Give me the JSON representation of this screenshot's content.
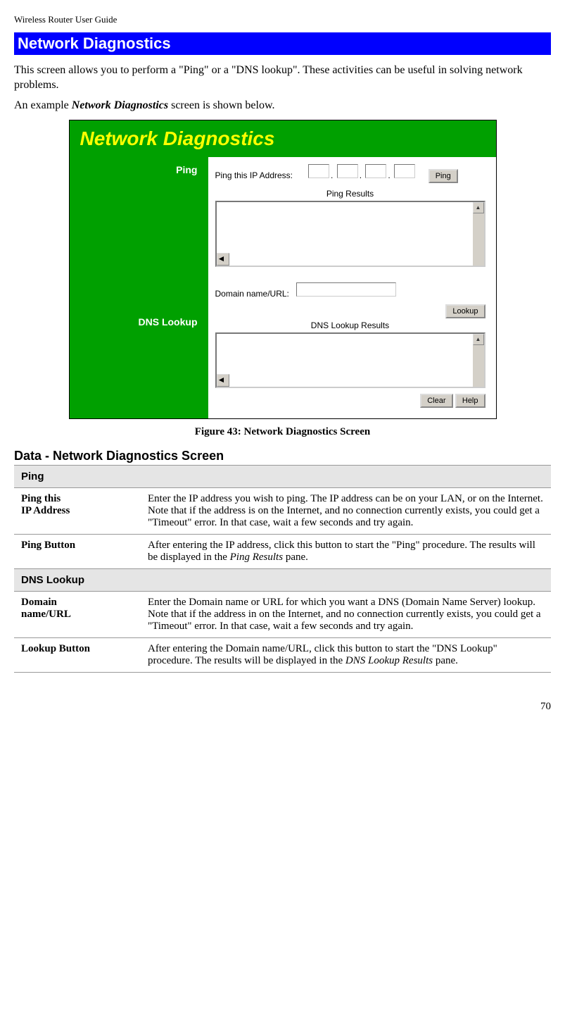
{
  "header": "Wireless Router User Guide",
  "section_title": "Network Diagnostics",
  "intro_p1_a": "This screen allows you to perform a \"Ping\" or a \"DNS lookup\". These activities can be useful in solving network problems.",
  "intro_p2_a": "An example ",
  "intro_p2_b": "Network Diagnostics",
  "intro_p2_c": " screen is shown below.",
  "screenshot": {
    "title": "Network Diagnostics",
    "ping_label": "Ping",
    "dns_label": "DNS Lookup",
    "ping_ip_label": "Ping this IP Address:",
    "ping_button": "Ping",
    "ping_results_label": "Ping Results",
    "domain_label": "Domain name/URL:",
    "lookup_button": "Lookup",
    "dns_results_label": "DNS Lookup Results",
    "clear_button": "Clear",
    "help_button": "Help"
  },
  "figure_caption": "Figure 43: Network Diagnostics Screen",
  "data_heading": "Data - Network Diagnostics Screen",
  "table": {
    "ping_section": "Ping",
    "ping_ip_label": "Ping this IP Address",
    "ping_ip_desc": "Enter the IP address you wish to ping. The IP address can be on your LAN, or on the Internet. Note that if the address is on the Internet, and no connection currently exists, you could get a \"Timeout\" error. In that case, wait a few seconds and try again.",
    "ping_button_label": "Ping Button",
    "ping_button_desc_a": "After entering the IP address, click this button to start the \"Ping\" procedure. The results will be displayed in the ",
    "ping_button_desc_b": "Ping Results",
    "ping_button_desc_c": " pane.",
    "dns_section": "DNS Lookup",
    "domain_label": "Domain name/URL",
    "domain_desc": "Enter the Domain name or URL for which you want a DNS (Domain Name Server) lookup. Note that if the address in on the Internet, and no connection currently exists, you could get a \"Timeout\" error. In that case, wait a few seconds and try again.",
    "lookup_label": "Lookup Button",
    "lookup_desc_a": "After entering the Domain name/URL, click this button to start the \"DNS Lookup\" procedure. The results will be displayed in the ",
    "lookup_desc_b": "DNS Lookup Results",
    "lookup_desc_c": " pane."
  },
  "page_number": "70"
}
